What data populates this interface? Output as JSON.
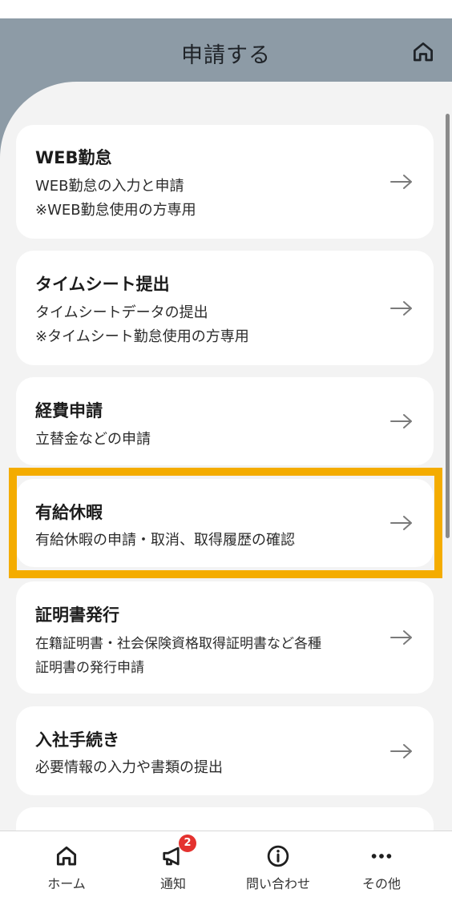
{
  "header": {
    "title": "申請する"
  },
  "cards": [
    {
      "title": "WEB勤怠",
      "lines": [
        "WEB勤怠の入力と申請",
        "※WEB勤怠使用の方専用"
      ]
    },
    {
      "title": "タイムシート提出",
      "lines": [
        "タイムシートデータの提出",
        "※タイムシート勤怠使用の方専用"
      ]
    },
    {
      "title": "経費申請",
      "lines": [
        "立替金などの申請"
      ]
    },
    {
      "title": "有給休暇",
      "lines": [
        "有給休暇の申請・取消、取得履歴の確認"
      ]
    },
    {
      "title": "証明書発行",
      "lines": [
        "在籍証明書・社会保険資格取得証明書など各種",
        "証明書の発行申請"
      ]
    },
    {
      "title": "入社手続き",
      "lines": [
        "必要情報の入力や書類の提出"
      ]
    }
  ],
  "nav": [
    {
      "label": "ホーム",
      "icon": "home-icon"
    },
    {
      "label": "通知",
      "icon": "megaphone-icon",
      "badge": "2"
    },
    {
      "label": "問い合わせ",
      "icon": "info-icon"
    },
    {
      "label": "その他",
      "icon": "more-icon"
    }
  ],
  "colors": {
    "header": "#8d9ba6",
    "highlight": "#f4ac00",
    "badge": "#e4322f",
    "content_bg": "#f3f3f3"
  }
}
